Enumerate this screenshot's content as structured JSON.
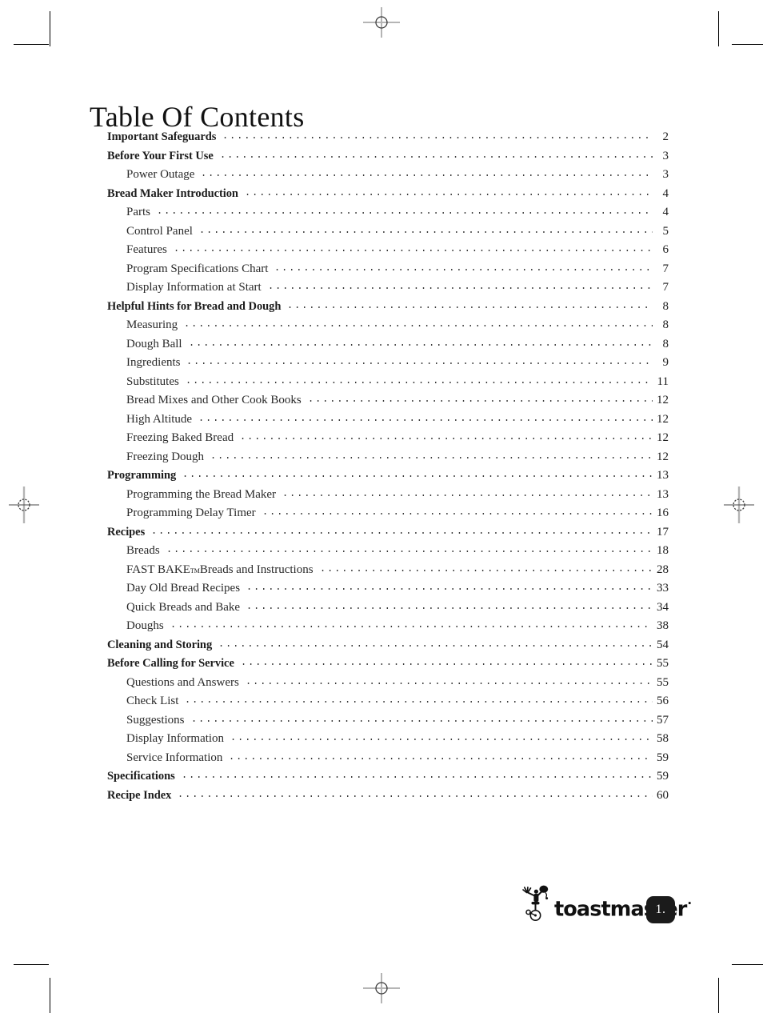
{
  "document": {
    "title": "Table Of Contents"
  },
  "toc": {
    "entries": [
      {
        "label": "Important Safeguards",
        "page": "2",
        "level": 1
      },
      {
        "label": "Before Your First Use",
        "page": "3",
        "level": 1
      },
      {
        "label": "Power Outage",
        "page": "3",
        "level": 2
      },
      {
        "label": "Bread Maker Introduction",
        "page": "4",
        "level": 1
      },
      {
        "label": "Parts",
        "page": "4",
        "level": 2
      },
      {
        "label": "Control Panel",
        "page": "5",
        "level": 2
      },
      {
        "label": "Features",
        "page": "6",
        "level": 2
      },
      {
        "label": "Program Specifications Chart",
        "page": "7",
        "level": 2
      },
      {
        "label": "Display Information at Start",
        "page": "7",
        "level": 2
      },
      {
        "label": "Helpful Hints for Bread and Dough",
        "page": "8",
        "level": 1
      },
      {
        "label": "Measuring",
        "page": "8",
        "level": 2
      },
      {
        "label": "Dough Ball",
        "page": "8",
        "level": 2
      },
      {
        "label": "Ingredients",
        "page": "9",
        "level": 2
      },
      {
        "label": "Substitutes",
        "page": "11",
        "level": 2
      },
      {
        "label": "Bread Mixes and Other Cook Books",
        "page": "12",
        "level": 2
      },
      {
        "label": "High Altitude",
        "page": "12",
        "level": 2
      },
      {
        "label": "Freezing Baked Bread",
        "page": "12",
        "level": 2
      },
      {
        "label": "Freezing Dough",
        "page": "12",
        "level": 2
      },
      {
        "label": "Programming",
        "page": "13",
        "level": 1
      },
      {
        "label": "Programming the Bread Maker",
        "page": "13",
        "level": 2
      },
      {
        "label": "Programming Delay Timer",
        "page": "16",
        "level": 2
      },
      {
        "label": "Recipes",
        "page": "17",
        "level": 1
      },
      {
        "label": "Breads",
        "page": "18",
        "level": 2
      },
      {
        "label": "FAST BAKE",
        "trademark": "TM",
        "label_suffix": " Breads and Instructions",
        "page": "28",
        "level": 2
      },
      {
        "label": "Day Old Bread Recipes",
        "page": "33",
        "level": 2
      },
      {
        "label": "Quick Breads and Bake",
        "page": "34",
        "level": 2
      },
      {
        "label": "Doughs",
        "page": "38",
        "level": 2
      },
      {
        "label": "Cleaning and Storing",
        "page": "54",
        "level": 1
      },
      {
        "label": "Before Calling for Service",
        "page": "55",
        "level": 1
      },
      {
        "label": "Questions and Answers",
        "page": "55",
        "level": 2
      },
      {
        "label": "Check List",
        "page": "56",
        "level": 2
      },
      {
        "label": "Suggestions",
        "page": "57",
        "level": 2
      },
      {
        "label": "Display Information",
        "page": "58",
        "level": 2
      },
      {
        "label": "Service Information",
        "page": "59",
        "level": 2
      },
      {
        "label": "Specifications",
        "page": "59",
        "level": 1
      },
      {
        "label": "Recipe Index",
        "page": "60",
        "level": 1
      }
    ]
  },
  "footer": {
    "brand": "toastmaster",
    "brand_mark": "·",
    "page_number": "1."
  },
  "colors": {
    "text": "#1c1c1c",
    "badge_background": "#1b1b1b",
    "badge_text": "#ffffff",
    "leader_dots": "#3a3a3a"
  }
}
